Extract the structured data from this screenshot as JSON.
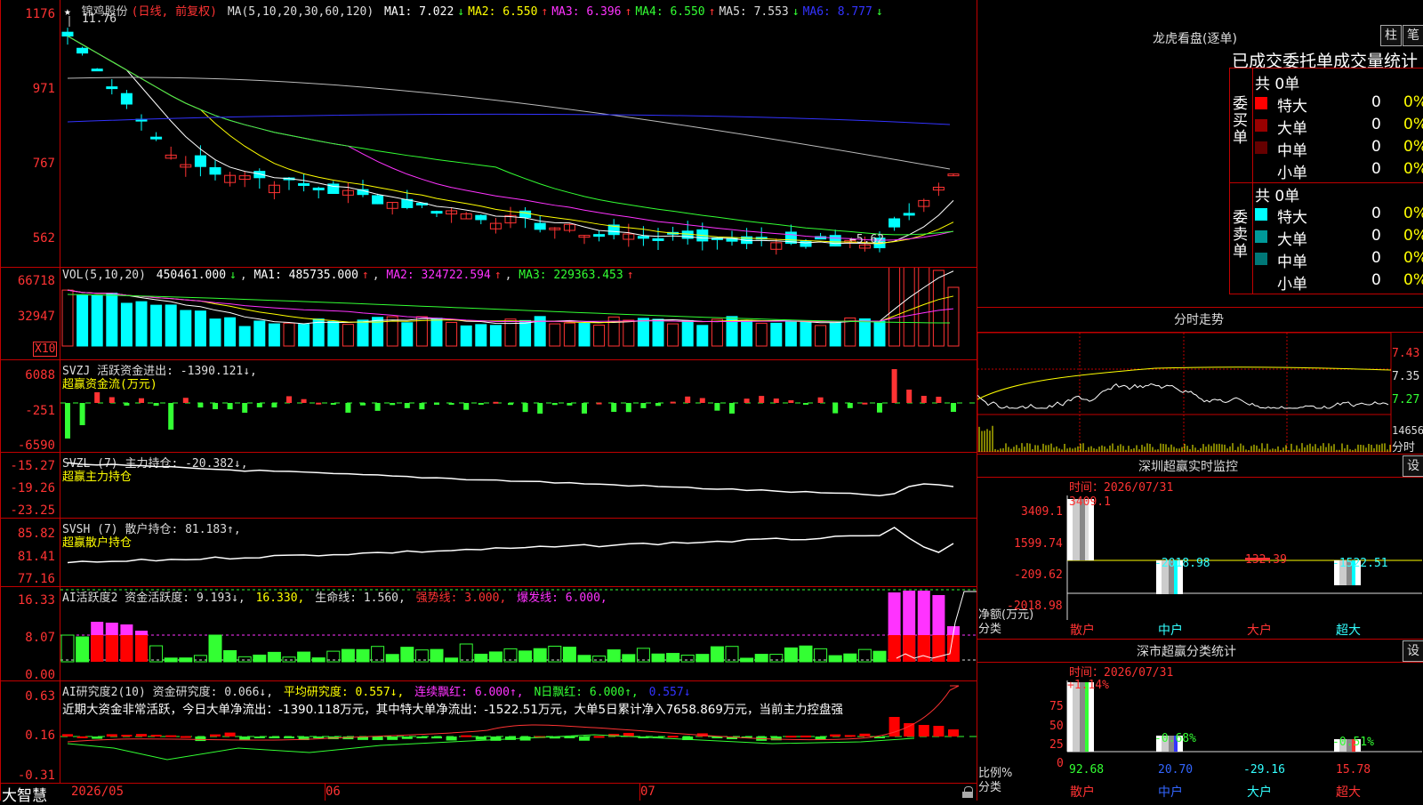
{
  "k": {
    "star": "★",
    "stock": "锦鸡股份",
    "period": "(日线, 前复权)",
    "ma_params": "MA(5,10,20,30,60,120)",
    "ma": [
      {
        "label": "MA1:",
        "value": "7.022",
        "arrow": "↓",
        "color": "#ffffff"
      },
      {
        "label": "MA2:",
        "value": "6.550",
        "arrow": "↑",
        "color": "#ffff00"
      },
      {
        "label": "MA3:",
        "value": "6.396",
        "arrow": "↑",
        "color": "#ff33ff"
      },
      {
        "label": "MA4:",
        "value": "6.550",
        "arrow": "↑",
        "color": "#33ff33"
      },
      {
        "label": "MA5:",
        "value": "7.553",
        "arrow": "↓",
        "color": "#dddddd"
      },
      {
        "label": "MA6:",
        "value": "8.777",
        "arrow": "↓",
        "color": "#3333ff"
      }
    ],
    "high_label": "11.76",
    "low_label": "←5.62",
    "yticks": [
      "1176",
      "971",
      "767",
      "562"
    ]
  },
  "vol": {
    "title": "VOL(5,10,20)",
    "value": "450461.000",
    "arrow": "↓",
    "ma1": "MA1: 485735.000",
    "ma2": "MA2: 324722.594",
    "ma3": "MA3: 229363.453",
    "yticks": [
      "66718",
      "32947"
    ],
    "unit": "X10"
  },
  "svzj": {
    "title": "SVZJ  活跃资金进出: -1390.121↓,",
    "sub": "超赢资金流(万元)",
    "yticks": [
      "6088",
      "-251",
      "-6590"
    ]
  },
  "svzl": {
    "title": "SVZL (7) 主力持仓: -20.382↓,",
    "sub": "超赢主力持仓",
    "yticks": [
      "-15.27",
      "-19.26",
      "-23.25"
    ]
  },
  "svsh": {
    "title": "SVSH (7) 散户持仓: 81.183↑,",
    "sub": "超赢散户持仓",
    "yticks": [
      "85.82",
      "81.41",
      "77.16"
    ]
  },
  "ai1": {
    "title": "AI活跃度2 资金活跃度: 9.193↓,",
    "v2": "16.330,",
    "v3": "生命线: 1.560,",
    "v4": "强势线: 3.000,",
    "v5": "爆发线: 6.000,",
    "yticks": [
      "16.33",
      "8.07",
      "0.00"
    ]
  },
  "ai2": {
    "title": "AI研究度2(10) 资金研究度: 0.066↓,",
    "p2": "平均研究度: 0.557↓,",
    "p3": "连续飘红: 6.000↑,",
    "p4": "N日飘红: 6.000↑,",
    "p5": "0.557↓",
    "note": "近期大资金非常活跃，今日大单净流出：-1390.118万元，其中特大单净流出：-1522.51万元，大单5日累计净入7658.869万元，当前主力控盘强",
    "yticks": [
      "0.63",
      "0.16",
      "-0.31"
    ]
  },
  "bottom": {
    "brand": "大智慧",
    "dates": [
      "2026/05",
      "06",
      "07"
    ]
  },
  "right": {
    "lhb_title": "龙虎看盘(逐单)",
    "btn_zhu": "柱",
    "btn_bi": "笔",
    "stats_title": "已成交委托单成交量统计",
    "buy_group": "委买单",
    "sell_group": "委卖单",
    "buy_total": "共 0单",
    "sell_total": "共 0单",
    "buy_rows": [
      {
        "name": "特大",
        "count": "0",
        "pct": "0%",
        "color": "#ff0000"
      },
      {
        "name": "大单",
        "count": "0",
        "pct": "0%",
        "color": "#990000"
      },
      {
        "name": "中单",
        "count": "0",
        "pct": "0%",
        "color": "#660000"
      },
      {
        "name": "小单",
        "count": "0",
        "pct": "0%",
        "color": "#000000"
      }
    ],
    "sell_rows": [
      {
        "name": "特大",
        "count": "0",
        "pct": "0%",
        "color": "#00ffff"
      },
      {
        "name": "大单",
        "count": "0",
        "pct": "0%",
        "color": "#009999"
      },
      {
        "name": "中单",
        "count": "0",
        "pct": "0%",
        "color": "#007777"
      },
      {
        "name": "小单",
        "count": "0",
        "pct": "0%",
        "color": "#000000"
      }
    ],
    "intraday_title": "分时走势",
    "intraday_prices": [
      "7.43",
      "7.35",
      "7.27"
    ],
    "intraday_vol": "14656",
    "intraday_vol_unit": "分时",
    "monitor_title": "深圳超赢实时监控",
    "monitor_btn": "设",
    "monitor_time": "时间：2026/07/31",
    "monitor_yticks": [
      "3409.1",
      "1599.74",
      "-209.62",
      "-2018.98"
    ],
    "monitor_ylabel1": "净额(万元)",
    "monitor_ylabel2": "分类",
    "monitor_values": [
      "3409.1",
      "-2018.98",
      "132.39",
      "-1522.51"
    ],
    "categories": [
      "散户",
      "中户",
      "大户",
      "超大"
    ],
    "class_title": "深市超赢分类统计",
    "class_btn": "设",
    "class_time": "时间：2026/07/31",
    "class_yticks": [
      "75",
      "50",
      "25",
      "0"
    ],
    "class_ylabel1": "比例%",
    "class_ylabel2": "分类",
    "class_pct": [
      "+1.14%",
      "-0.68%",
      "-0.51%"
    ],
    "class_values": [
      "92.68",
      "20.70",
      "-29.16",
      "15.78"
    ]
  }
}
